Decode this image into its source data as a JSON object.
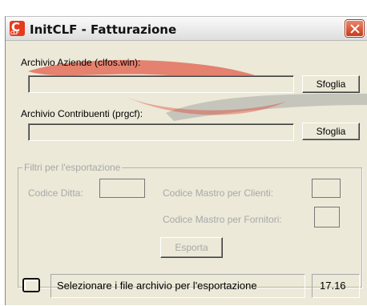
{
  "window": {
    "title": "InitCLF - Fatturazione",
    "icon_letters": "CLF"
  },
  "files": {
    "aziende_label": "Archivio Aziende (clfos.win):",
    "aziende_value": "",
    "contribuenti_label": "Archivio Contribuenti (prgcf):",
    "contribuenti_value": "",
    "browse_label": "Sfoglia"
  },
  "filters": {
    "group_label": "Filtri per l'esportazione",
    "codice_ditta_label": "Codice Ditta:",
    "mastro_clienti_label": "Codice Mastro per Clienti:",
    "mastro_fornitori_label": "Codice Mastro per Fornitori:",
    "esporta_label": "Esporta"
  },
  "status": {
    "message": "Selezionare i file archivio per l'esportazione",
    "time": "17.16"
  },
  "colors": {
    "window_bg": "#ece9d8",
    "close_button": "#c83b19",
    "app_icon": "#e53b1c",
    "disabled_text": "#a8a8a8"
  }
}
